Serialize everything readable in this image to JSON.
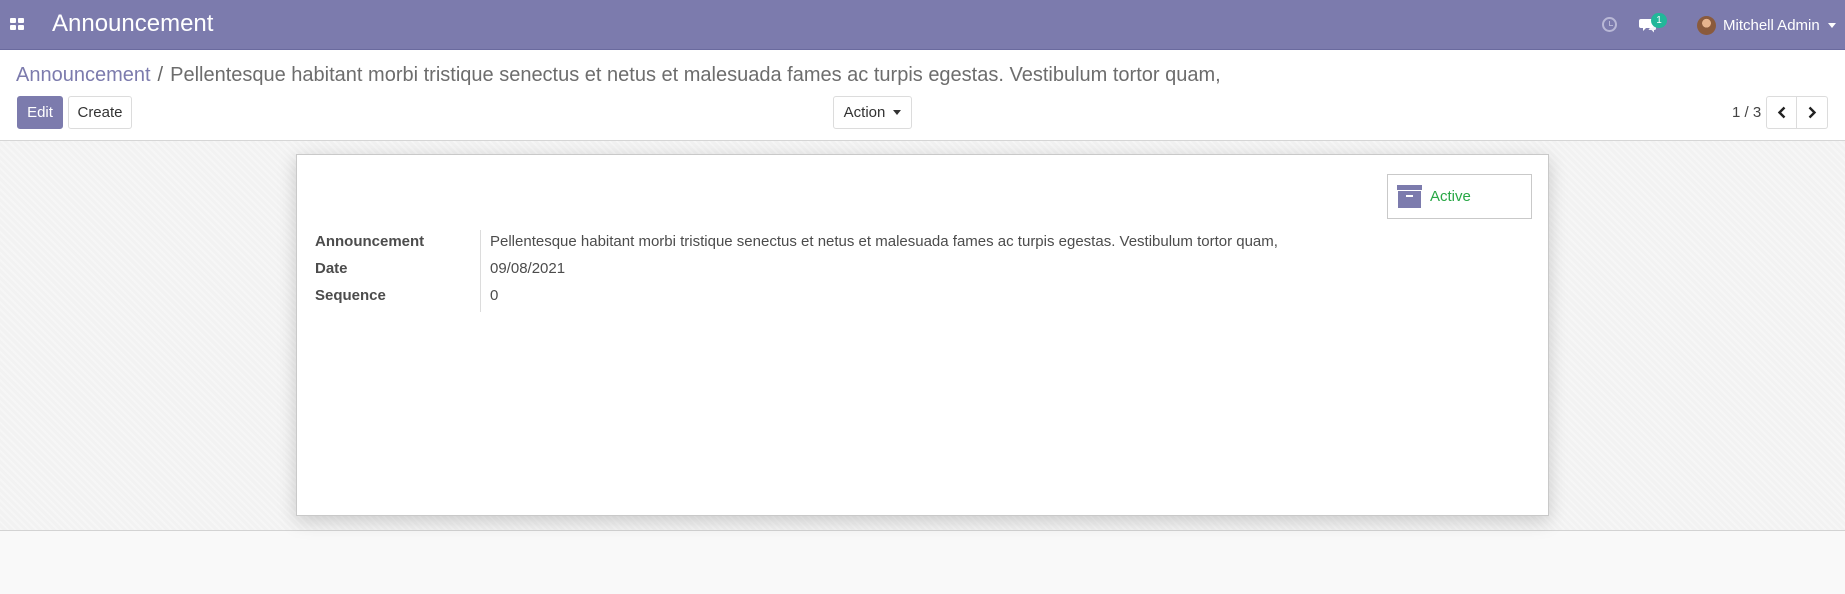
{
  "navbar": {
    "app_title": "Announcement",
    "chat_badge": "1",
    "user_name": "Mitchell Admin",
    "icons": [
      "apps-icon",
      "clock-icon",
      "chat-icon",
      "avatar",
      "caret-down-icon"
    ]
  },
  "breadcrumb": {
    "parent": "Announcement",
    "separator": "/",
    "current": "Pellentesque habitant morbi tristique senectus et netus et malesuada fames ac turpis egestas. Vestibulum tortor quam,"
  },
  "buttons": {
    "edit": "Edit",
    "create": "Create",
    "action": "Action"
  },
  "pager": {
    "value": "1 / 3"
  },
  "form": {
    "status_button": "Active",
    "fields": [
      {
        "label": "Announcement",
        "value": "Pellentesque habitant morbi tristique senectus et netus et malesuada fames ac turpis egestas. Vestibulum tortor quam,"
      },
      {
        "label": "Date",
        "value": "09/08/2021"
      },
      {
        "label": "Sequence",
        "value": "0"
      }
    ]
  },
  "colors": {
    "brand": "#7c7bad",
    "active_text": "#28a745",
    "badge": "#21b799"
  }
}
